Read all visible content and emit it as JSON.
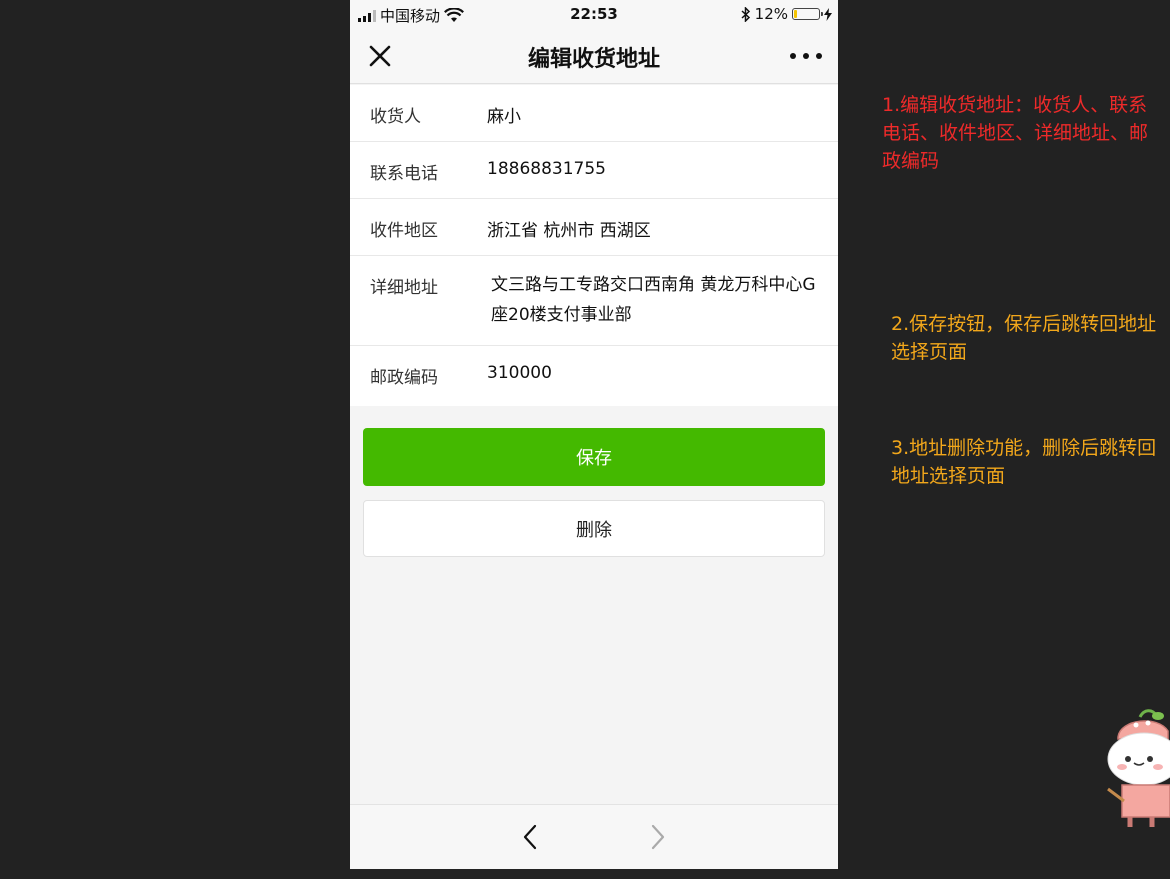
{
  "status_bar": {
    "carrier": "中国移动",
    "time": "22:53",
    "battery_percent": "12%",
    "battery_level": 0.12
  },
  "nav": {
    "title": "编辑收货地址",
    "close_icon": "close-icon",
    "more_icon": "more-icon"
  },
  "form": {
    "rows": [
      {
        "label": "收货人",
        "value": "麻小"
      },
      {
        "label": "联系电话",
        "value": "18868831755"
      },
      {
        "label": "收件地区",
        "value": "浙江省 杭州市 西湖区"
      },
      {
        "label": "详细地址",
        "value": "文三路与工专路交口西南角 黄龙万科中心G座20楼支付事业部"
      },
      {
        "label": "邮政编码",
        "value": "310000"
      }
    ]
  },
  "buttons": {
    "save_label": "保存",
    "delete_label": "删除"
  },
  "bottom_bar": {
    "back_icon": "chevron-left-icon",
    "forward_icon": "chevron-right-icon"
  },
  "annotations": {
    "note1": "1.编辑收货地址：收货人、联系电话、收件地区、详细地址、邮政编码",
    "note2": "2.保存按钮，保存后跳转回地址选择页面",
    "note3": "3.地址删除功能，删除后跳转回地址选择页面"
  },
  "colors": {
    "accent": "#44b900",
    "note_red": "#ee2a2a",
    "note_orange": "#f2a71b"
  }
}
